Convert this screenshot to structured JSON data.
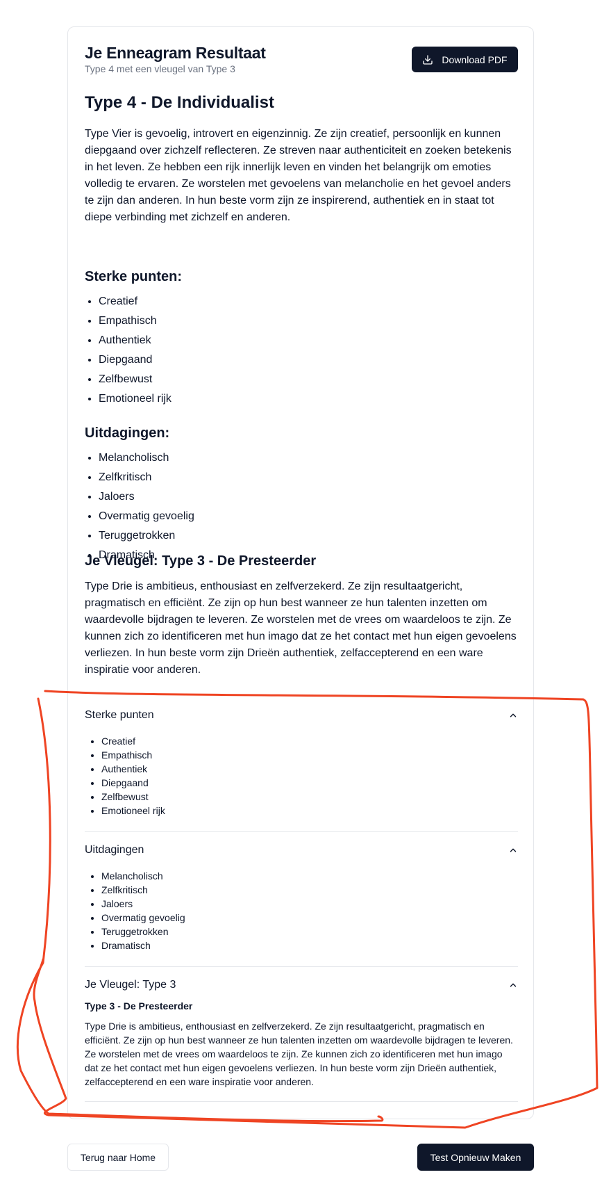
{
  "header": {
    "title": "Je Enneagram Resultaat",
    "subtitle": "Type 4 met een vleugel van Type 3",
    "download_label": "Download PDF",
    "download_icon": "download-icon"
  },
  "type": {
    "title": "Type 4 - De Individualist",
    "description": "Type Vier is gevoelig, introvert en eigenzinnig. Ze zijn creatief, persoonlijk en kunnen diepgaand over zichzelf reflecteren. Ze streven naar authenticiteit en zoeken betekenis in het leven. Ze hebben een rijk innerlijk leven en vinden het belangrijk om emoties volledig te ervaren. Ze worstelen met gevoelens van melancholie en het gevoel anders te zijn dan anderen. In hun beste vorm zijn ze inspirerend, authentiek en in staat tot diepe verbinding met zichzelf en anderen."
  },
  "strengths": {
    "heading": "Sterke punten:",
    "items": [
      "Creatief",
      "Empathisch",
      "Authentiek",
      "Diepgaand",
      "Zelfbewust",
      "Emotioneel rijk"
    ]
  },
  "challenges": {
    "heading": "Uitdagingen:",
    "items": [
      "Melancholisch",
      "Zelfkritisch",
      "Jaloers",
      "Overmatig gevoelig",
      "Teruggetrokken",
      "Dramatisch"
    ]
  },
  "wing": {
    "heading": "Je Vleugel: Type 3 - De Presteerder",
    "description": "Type Drie is ambitieus, enthousiast en zelfverzekerd. Ze zijn resultaatgericht, pragmatisch en efficiënt. Ze zijn op hun best wanneer ze hun talenten inzetten om waardevolle bijdragen te leveren. Ze worstelen met de vrees om waardeloos te zijn. Ze kunnen zich zo identificeren met hun imago dat ze het contact met hun eigen gevoelens verliezen. In hun beste vorm zijn Drieën authentiek, zelfaccepterend en een ware inspiratie voor anderen."
  },
  "accordion": {
    "strengths": {
      "label": "Sterke punten",
      "items": [
        "Creatief",
        "Empathisch",
        "Authentiek",
        "Diepgaand",
        "Zelfbewust",
        "Emotioneel rijk"
      ]
    },
    "challenges": {
      "label": "Uitdagingen",
      "items": [
        "Melancholisch",
        "Zelfkritisch",
        "Jaloers",
        "Overmatig gevoelig",
        "Teruggetrokken",
        "Dramatisch"
      ]
    },
    "wing": {
      "label": "Je Vleugel: Type 3",
      "subtitle": "Type 3 - De Presteerder",
      "description": "Type Drie is ambitieus, enthousiast en zelfverzekerd. Ze zijn resultaatgericht, pragmatisch en efficiënt. Ze zijn op hun best wanneer ze hun talenten inzetten om waardevolle bijdragen te leveren. Ze worstelen met de vrees om waardeloos te zijn. Ze kunnen zich zo identificeren met hun imago dat ze het contact met hun eigen gevoelens verliezen. In hun beste vorm zijn Drieën authentiek, zelfaccepterend en een ware inspiratie voor anderen."
    },
    "chevron_icon": "chevron-up-icon"
  },
  "footer": {
    "home_label": "Terug naar Home",
    "retake_label": "Test Opnieuw Maken"
  },
  "colors": {
    "primary": "#0f172a",
    "border": "#e5e7eb",
    "muted": "#6b7280",
    "annotation": "#ef4423"
  }
}
